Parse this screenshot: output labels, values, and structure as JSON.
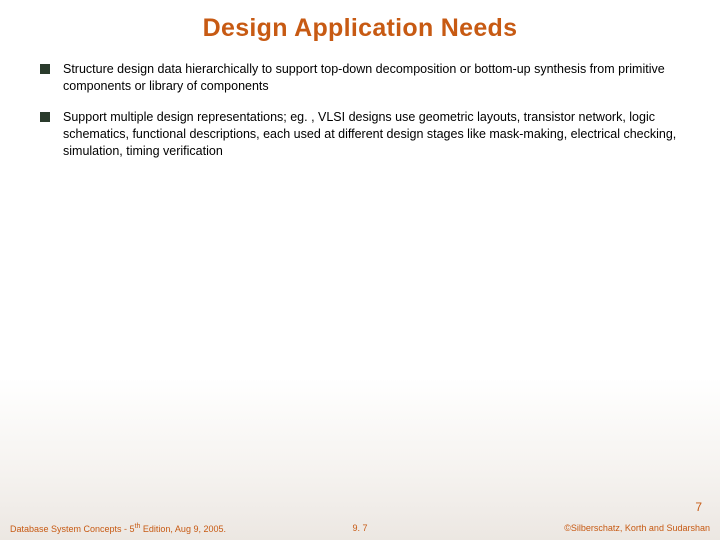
{
  "title": "Design Application Needs",
  "bullets": [
    "Structure design data hierarchically to support top-down decomposition or bottom-up synthesis from primitive components or library of components",
    "Support multiple design representations; eg. , VLSI designs use geometric layouts, transistor network, logic schematics, functional descriptions, each used at different design stages like mask-making, electrical checking, simulation, timing verification"
  ],
  "pageNumber": "7",
  "footer": {
    "left_prefix": "Database System Concepts - 5",
    "left_suffix": " Edition, Aug 9, 2005.",
    "left_sup": "th",
    "center": "9. 7",
    "right": "©Silberschatz, Korth and Sudarshan"
  }
}
